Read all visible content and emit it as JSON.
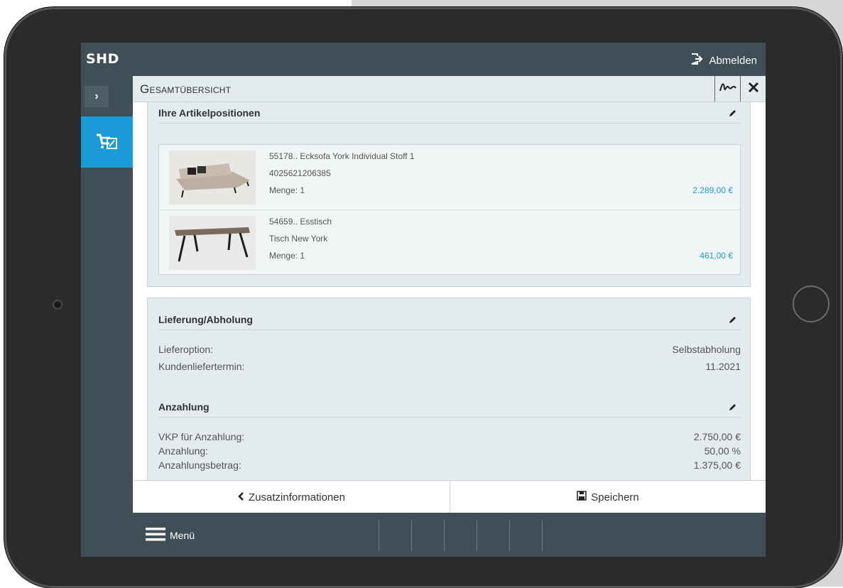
{
  "app": {
    "logo": "SHD",
    "logout_label": "Abmelden"
  },
  "sidebar": {
    "toggle_label": "›",
    "items": [
      {
        "icon": "cart-edit-icon",
        "active": true
      }
    ]
  },
  "page": {
    "title": "Gesamtübersicht"
  },
  "articles": {
    "title": "Ihre Artikelpositionen",
    "items": [
      {
        "line1": "55178..  Ecksofa York Individual Stoff 1",
        "line2": "4025621206385",
        "line3": "Menge: 1",
        "price": "2.289,00 €"
      },
      {
        "line1": "54659..  Esstisch",
        "line2": "Tisch New York",
        "line3": "Menge: 1",
        "price": "461,00 €"
      }
    ]
  },
  "delivery": {
    "title": "Lieferung/Abholung",
    "rows": [
      {
        "label": "Lieferoption:",
        "value": "Selbstabholung"
      },
      {
        "label": "Kundenliefertermin:",
        "value": "11.2021"
      }
    ]
  },
  "deposit": {
    "title": "Anzahlung",
    "rows": [
      {
        "label": "VKP für Anzahlung:",
        "value": "2.750,00 €"
      },
      {
        "label": "Anzahlung:",
        "value": "50,00 %"
      },
      {
        "label": "Anzahlungsbetrag:",
        "value": "1.375,00 €"
      }
    ]
  },
  "actions": {
    "back_label": "Zusatzinformationen",
    "save_label": "Speichern"
  },
  "footer": {
    "menu_label": "Menü"
  },
  "colors": {
    "accent": "#1a9ad6",
    "bar": "#3f4e57",
    "panel": "#e3ebee"
  }
}
